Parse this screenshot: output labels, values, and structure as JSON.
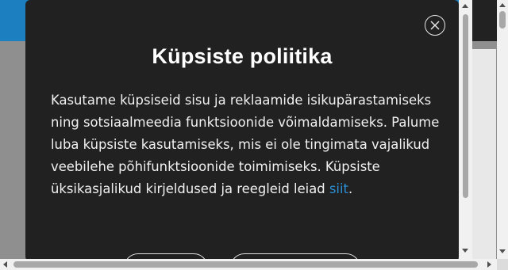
{
  "modal": {
    "close_icon": "close-circle-icon",
    "title": "Küpsiste poliitika",
    "body_text": "Kasutame küpsiseid sisu ja reklaamide isikupärastamiseks ning sotsiaalmeedia funktsioonide võimaldamiseks. Palume luba küpsiste kasutamiseks, mis ei ole tingimata vajalikud veebilehe põhifunktsioonide toimimiseks. Küpsiste üksikasjalikud kirjeldused ja reegleid leiad ",
    "link_text": "siit",
    "body_end": "."
  },
  "colors": {
    "header_blue": "#1c7fbf",
    "modal_bg": "#212121",
    "link": "#2b8fd6"
  }
}
